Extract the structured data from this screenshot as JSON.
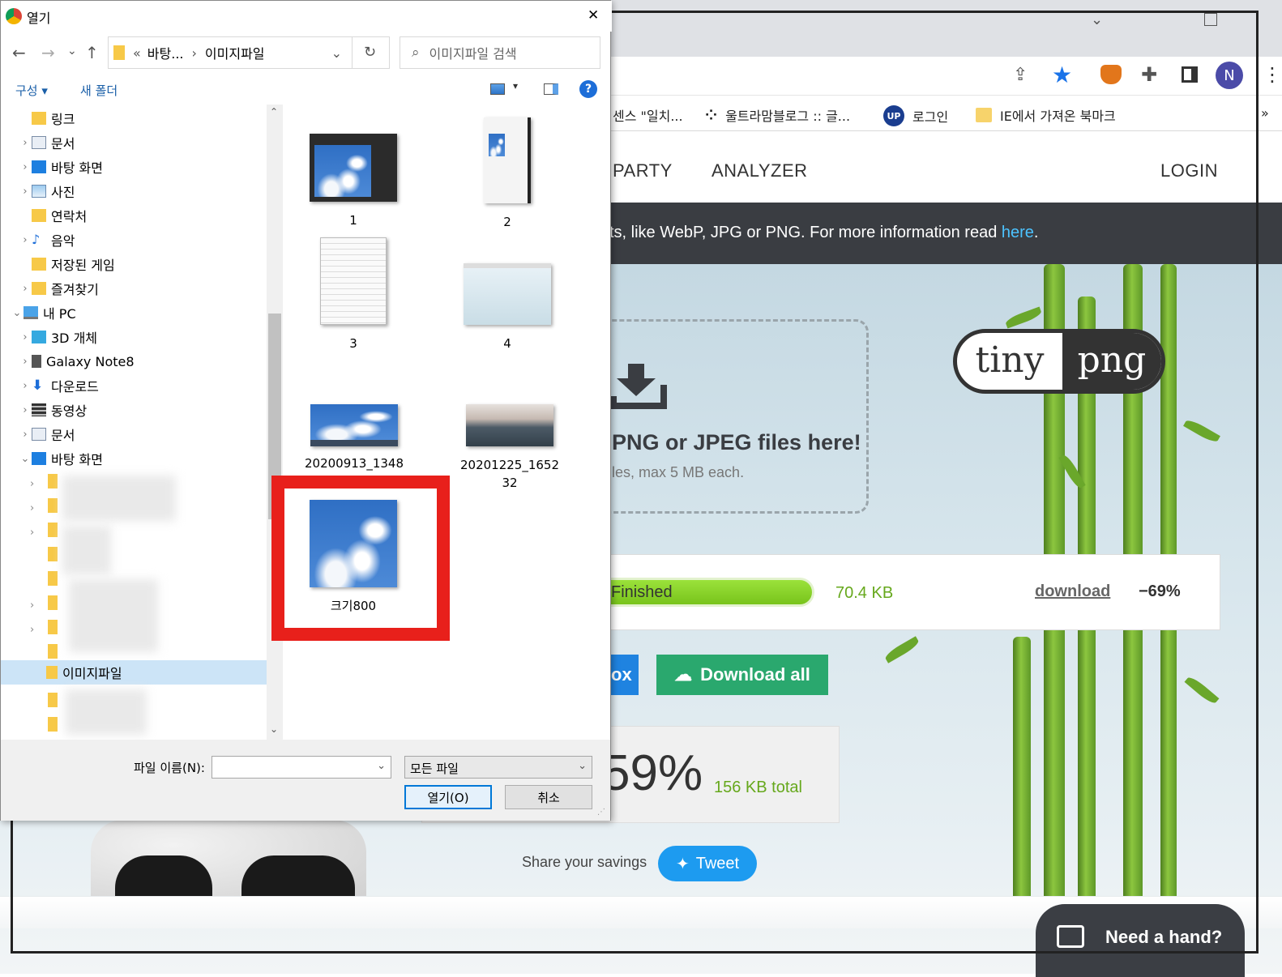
{
  "browser": {
    "bookmarks": [
      {
        "label": "센스 \"일치...",
        "icon": "bookmark-page-icon"
      },
      {
        "label": "울트라맘블로그 :: 글...",
        "icon": "ultramom-icon"
      },
      {
        "label": "로그인",
        "icon": "up-logo-icon"
      },
      {
        "label": "IE에서 가져온 북마크",
        "icon": "folder-icon"
      }
    ],
    "profile_initial": "N",
    "more_bookmarks": "»"
  },
  "site": {
    "nav": [
      "PARTY",
      "ANALYZER"
    ],
    "login": "LOGIN",
    "banner_text": "ts, like WebP, JPG or PNG. For more information read ",
    "banner_link": "here",
    "banner_end": ".",
    "logo_left": "tiny",
    "logo_right": "png",
    "drop_title": "PNG or JPEG files here!",
    "drop_sub": "les, max 5 MB each.",
    "result": {
      "status": "Finished",
      "size": "70.4 KB",
      "download": "download",
      "percent": "−69%"
    },
    "dropbox_label": "ox",
    "download_all": "Download all",
    "savings_percent": "59%",
    "savings_total": "156 KB total",
    "share_text": "Share your savings",
    "tweet": "Tweet",
    "chat": "Need a hand?"
  },
  "dialog": {
    "title": "열기",
    "close": "✕",
    "breadcrumb": [
      "바탕...",
      "이미지파일"
    ],
    "breadcrumb_prefix": "«",
    "search_placeholder": "이미지파일 검색",
    "organize": "구성 ▾",
    "new_folder": "새 폴더",
    "help": "?",
    "tree": [
      {
        "label": "링크",
        "expand": "",
        "icon": "link-folder-icon"
      },
      {
        "label": "문서",
        "expand": "›",
        "icon": "document-icon"
      },
      {
        "label": "바탕 화면",
        "expand": "›",
        "icon": "desktop-icon"
      },
      {
        "label": "사진",
        "expand": "›",
        "icon": "pictures-icon"
      },
      {
        "label": "연락처",
        "expand": "",
        "icon": "contacts-icon"
      },
      {
        "label": "음악",
        "expand": "›",
        "icon": "music-icon"
      },
      {
        "label": "저장된 게임",
        "expand": "",
        "icon": "saved-games-icon"
      },
      {
        "label": "즐겨찾기",
        "expand": "›",
        "icon": "favorites-icon"
      },
      {
        "label": "내 PC",
        "expand": "⌄",
        "icon": "this-pc-icon"
      },
      {
        "label": "3D 개체",
        "expand": "›",
        "icon": "3d-objects-icon"
      },
      {
        "label": "Galaxy Note8",
        "expand": "›",
        "icon": "phone-icon"
      },
      {
        "label": "다운로드",
        "expand": "›",
        "icon": "download-icon"
      },
      {
        "label": "동영상",
        "expand": "›",
        "icon": "videos-icon"
      },
      {
        "label": "문서",
        "expand": "›",
        "icon": "document-icon"
      },
      {
        "label": "바탕 화면",
        "expand": "⌄",
        "icon": "desktop-icon"
      }
    ],
    "selected_folder": "이미지파일",
    "files": [
      {
        "name": "1"
      },
      {
        "name": "2"
      },
      {
        "name": "3"
      },
      {
        "name": "4"
      },
      {
        "name": "20200913_1348"
      },
      {
        "name": "20201225_1652\n32"
      },
      {
        "name": "크기800"
      }
    ],
    "filename_label": "파일 이름(N):",
    "filename_value": "",
    "filetype": "모든 파일",
    "open": "열기(O)",
    "cancel": "취소"
  }
}
